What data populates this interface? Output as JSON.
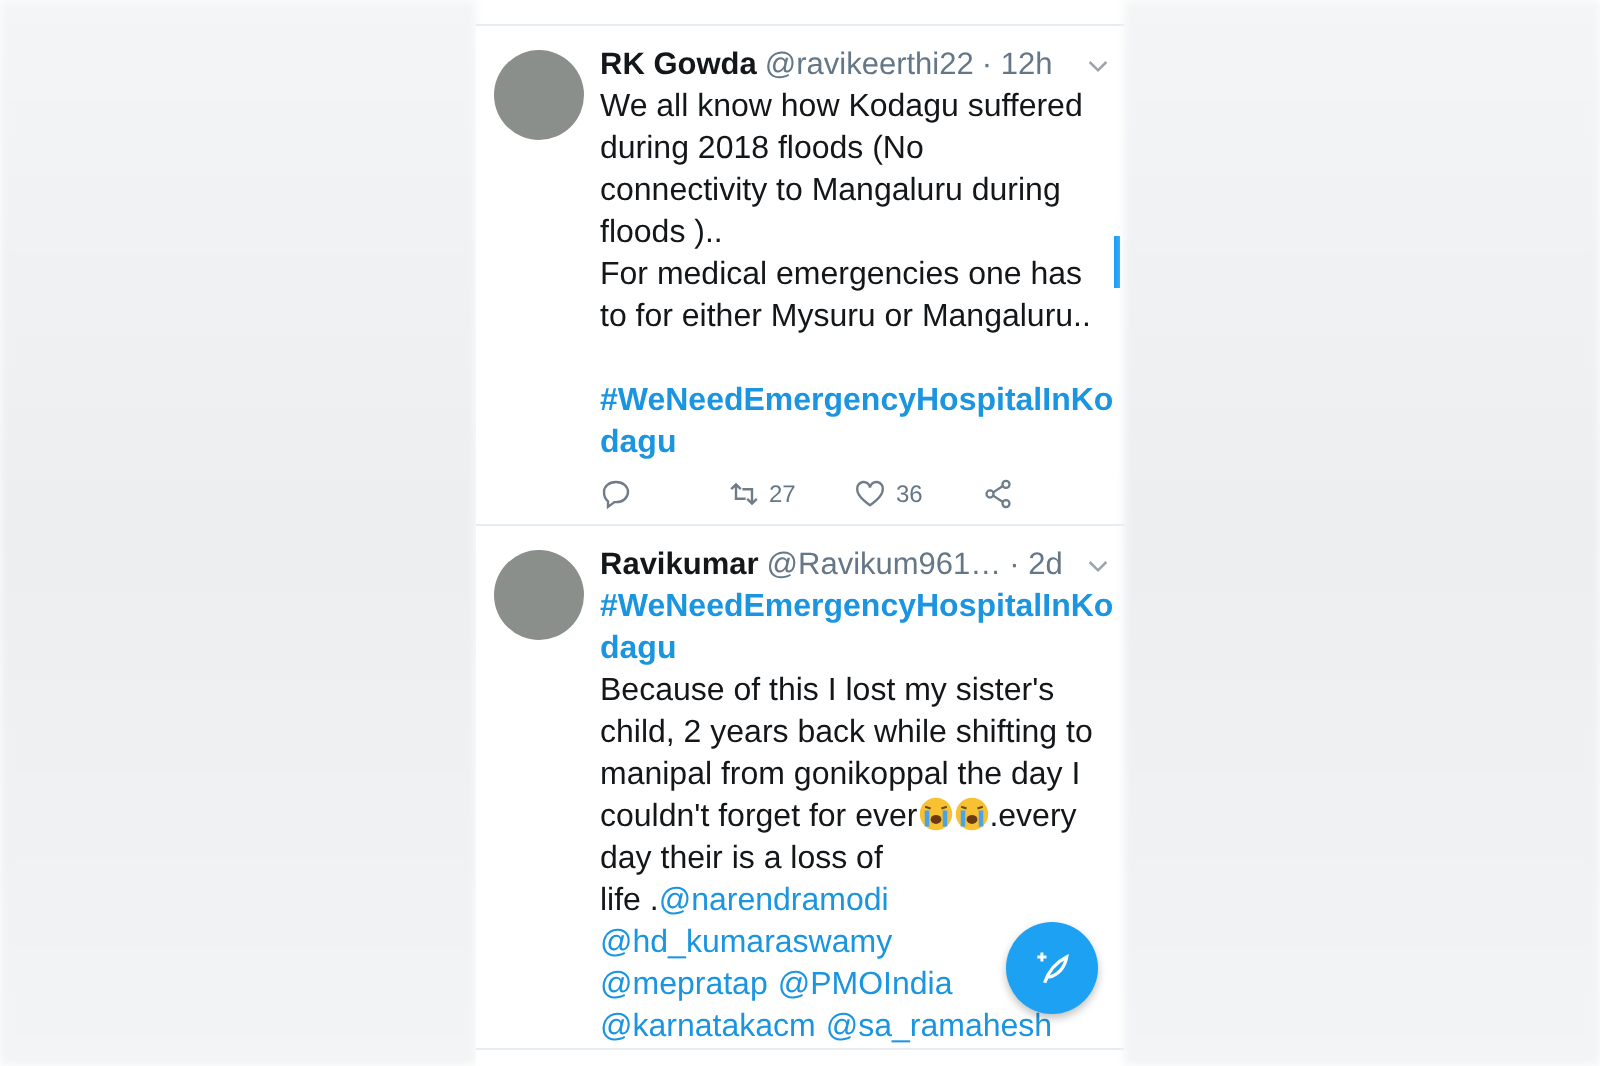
{
  "tweets": [
    {
      "name": "RK Gowda",
      "handle": "@ravikeerthi22",
      "time": "· 12h",
      "lines": [
        [
          {
            "kind": "text",
            "text": "We all know how Kodagu suffered"
          }
        ],
        [
          {
            "kind": "text",
            "text": "during 2018 floods (No"
          }
        ],
        [
          {
            "kind": "text",
            "text": "connectivity to Mangaluru during"
          }
        ],
        [
          {
            "kind": "text",
            "text": "floods ).."
          }
        ],
        [
          {
            "kind": "text",
            "text": "For medical emergencies one has"
          }
        ],
        [
          {
            "kind": "text",
            "text": "to for either Mysuru or Mangaluru.."
          }
        ],
        [
          {
            "kind": "hashtag",
            "text": "#WeNeedEmergencyHospitalInKo",
            "gap_before": true
          }
        ],
        [
          {
            "kind": "hashtag",
            "text": "dagu"
          }
        ]
      ],
      "actions": [
        {
          "kind": "reply"
        },
        {
          "kind": "retweet",
          "count": "27"
        },
        {
          "kind": "like",
          "count": "36"
        },
        {
          "kind": "share"
        }
      ]
    },
    {
      "name": "Ravikumar",
      "handle": "@Ravikum961…",
      "time": "· 2d",
      "lines": [
        [
          {
            "kind": "hashtag",
            "text": "#WeNeedEmergencyHospitalInKo"
          }
        ],
        [
          {
            "kind": "hashtag",
            "text": "dagu"
          }
        ],
        [
          {
            "kind": "text",
            "text": "Because of this I lost my sister's"
          }
        ],
        [
          {
            "kind": "text",
            "text": "child, 2 years back while shifting to"
          }
        ],
        [
          {
            "kind": "text",
            "text": "manipal from gonikoppal the day I"
          }
        ],
        [
          {
            "kind": "text",
            "text": "couldn't forget for ever"
          },
          {
            "kind": "emoji"
          },
          {
            "kind": "emoji"
          },
          {
            "kind": "text",
            "text": ".every"
          }
        ],
        [
          {
            "kind": "text",
            "text": "day their is a loss of"
          }
        ],
        [
          {
            "kind": "text",
            "text": "life ."
          },
          {
            "kind": "mention",
            "text": "@narendramodi"
          }
        ],
        [
          {
            "kind": "mention",
            "text": "@hd_kumaraswamy"
          }
        ],
        [
          {
            "kind": "mention",
            "text": "@mepratap"
          },
          {
            "kind": "mention",
            "text": "@PMOIndia"
          }
        ],
        [
          {
            "kind": "mention",
            "text": "@karnatakacm"
          },
          {
            "kind": "mention",
            "text": "@sa_ramahesh"
          }
        ]
      ]
    }
  ]
}
